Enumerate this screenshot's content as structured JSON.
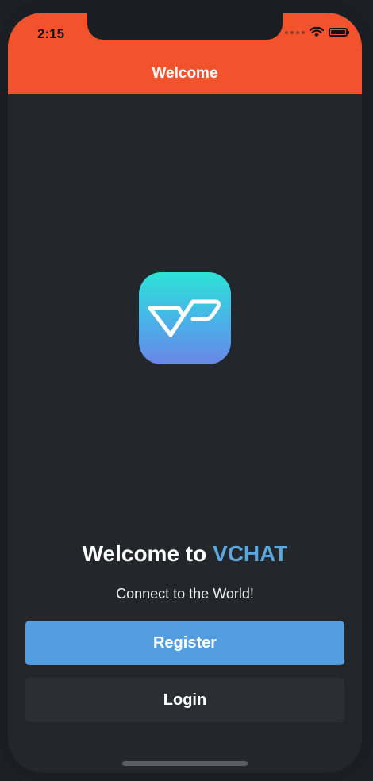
{
  "status_bar": {
    "time": "2:15",
    "icons": [
      "cellular-signal-icon",
      "wifi-icon",
      "battery-icon"
    ]
  },
  "header": {
    "title": "Welcome",
    "color": "#f2532d"
  },
  "logo": {
    "icon": "vchat-logo-icon"
  },
  "main": {
    "welcome_prefix": "Welcome to",
    "brand_name": "VCHAT",
    "brand_color": "#5aa9de",
    "tagline": "Connect to the World!"
  },
  "actions": {
    "register_label": "Register",
    "login_label": "Login"
  },
  "colors": {
    "background": "#23272b",
    "register_button": "#529ee0",
    "login_button": "#2b2f34"
  }
}
